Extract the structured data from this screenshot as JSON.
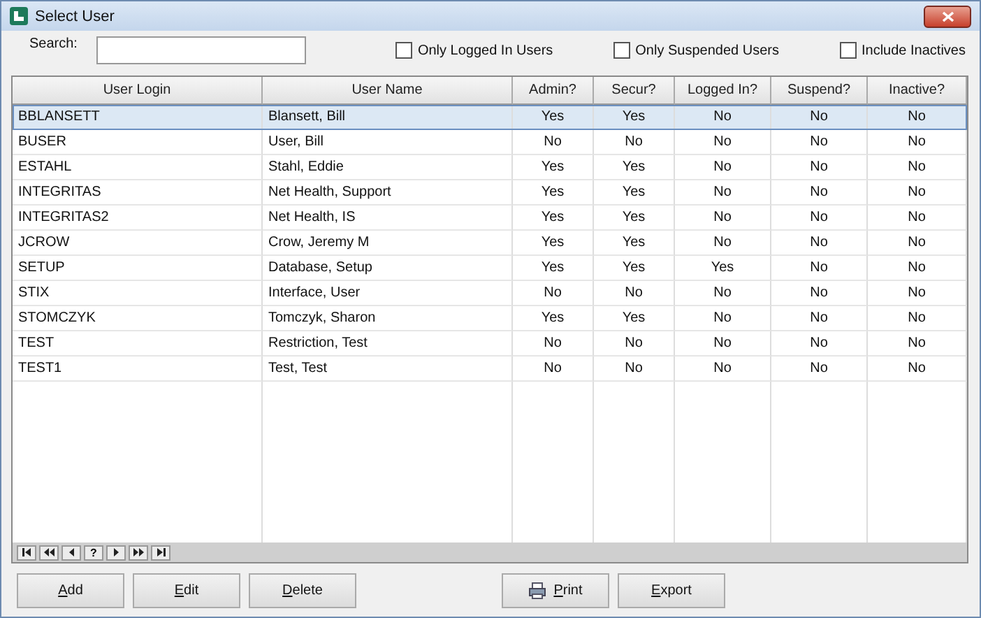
{
  "window": {
    "title": "Select User"
  },
  "search": {
    "label": "Search:"
  },
  "filters": [
    {
      "label": "Only Logged In Users",
      "checked": false
    },
    {
      "label": "Only Suspended Users",
      "checked": false
    },
    {
      "label": "Include Inactives",
      "checked": false
    }
  ],
  "table": {
    "columns": [
      "User Login",
      "User Name",
      "Admin?",
      "Secur?",
      "Logged In?",
      "Suspend?",
      "Inactive?"
    ],
    "rows": [
      {
        "selected": true,
        "cells": [
          "BBLANSETT",
          "Blansett, Bill",
          "Yes",
          "Yes",
          "No",
          "No",
          "No"
        ]
      },
      {
        "selected": false,
        "cells": [
          "BUSER",
          "User, Bill",
          "No",
          "No",
          "No",
          "No",
          "No"
        ]
      },
      {
        "selected": false,
        "cells": [
          "ESTAHL",
          "Stahl, Eddie",
          "Yes",
          "Yes",
          "No",
          "No",
          "No"
        ]
      },
      {
        "selected": false,
        "cells": [
          "INTEGRITAS",
          "Net Health, Support",
          "Yes",
          "Yes",
          "No",
          "No",
          "No"
        ]
      },
      {
        "selected": false,
        "cells": [
          "INTEGRITAS2",
          "Net Health, IS",
          "Yes",
          "Yes",
          "No",
          "No",
          "No"
        ]
      },
      {
        "selected": false,
        "cells": [
          "JCROW",
          "Crow, Jeremy M",
          "Yes",
          "Yes",
          "No",
          "No",
          "No"
        ]
      },
      {
        "selected": false,
        "cells": [
          "SETUP",
          "Database, Setup",
          "Yes",
          "Yes",
          "Yes",
          "No",
          "No"
        ]
      },
      {
        "selected": false,
        "cells": [
          "STIX",
          "Interface, User",
          "No",
          "No",
          "No",
          "No",
          "No"
        ]
      },
      {
        "selected": false,
        "cells": [
          "STOMCZYK",
          "Tomczyk, Sharon",
          "Yes",
          "Yes",
          "No",
          "No",
          "No"
        ]
      },
      {
        "selected": false,
        "cells": [
          "TEST",
          "Restriction, Test",
          "No",
          "No",
          "No",
          "No",
          "No"
        ]
      },
      {
        "selected": false,
        "cells": [
          "TEST1",
          "Test, Test",
          "No",
          "No",
          "No",
          "No",
          "No"
        ]
      }
    ]
  },
  "navigator": [
    {
      "kind": "first"
    },
    {
      "kind": "prev-page"
    },
    {
      "kind": "prev"
    },
    {
      "kind": "text",
      "label": "?"
    },
    {
      "kind": "next"
    },
    {
      "kind": "next-page"
    },
    {
      "kind": "last"
    }
  ],
  "buttons": [
    {
      "label": "Add"
    },
    {
      "label": "Edit"
    },
    {
      "label": "Delete"
    },
    {
      "label": "Print"
    },
    {
      "label": "Export"
    }
  ]
}
